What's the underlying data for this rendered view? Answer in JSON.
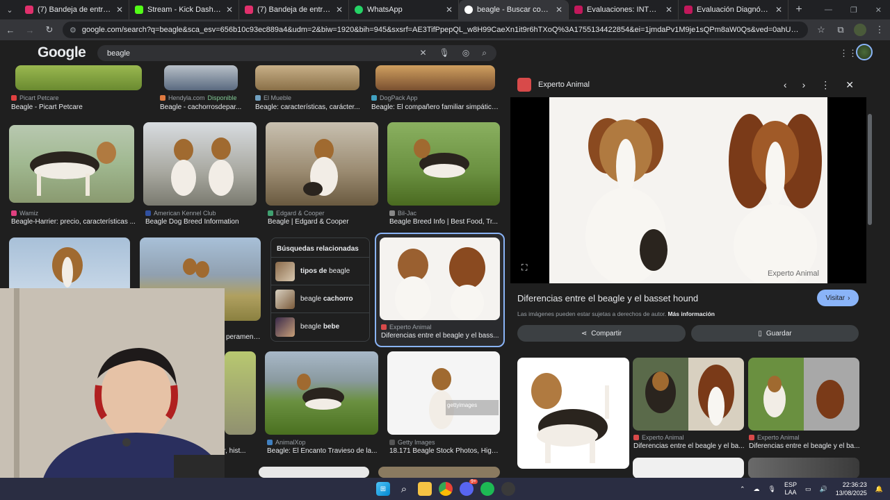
{
  "browser": {
    "tabs": [
      {
        "title": "(7) Bandeja de entrada • Chats",
        "color": "#e1306c"
      },
      {
        "title": "Stream - Kick Dashboard",
        "color": "#53fc18"
      },
      {
        "title": "(7) Bandeja de entrada • Chats",
        "color": "#e1306c"
      },
      {
        "title": "WhatsApp",
        "color": "#25d366"
      },
      {
        "title": "beagle - Buscar con Google",
        "color": "#ffffff"
      },
      {
        "title": "Evaluaciones: INTRODUCCION",
        "color": "#c2185b"
      },
      {
        "title": "Evaluación Diagnóstica: INTRO",
        "color": "#c2185b"
      }
    ],
    "active_tab": 4,
    "url": "google.com/search?q=beagle&sca_esv=656b10c93ec889a4&udm=2&biw=1920&bih=945&sxsrf=AE3TifPpepQL_w8H99CaeXn1it9r6hTXoQ%3A1755134422854&ei=1jmdaPv1M9je1sQPm8aW0Qs&ved=0ahUKEwj7uLqekYmPAxVYr5UCHRujJboQ4dUDCBE..."
  },
  "google": {
    "logo": "Google",
    "query": "beagle"
  },
  "results": {
    "row1": [
      {
        "source": "Picart Petcare",
        "caption": "Beagle - Picart Petcare",
        "extra": ""
      },
      {
        "source": "Hendyla.com",
        "caption": "Beagle - cachorrosdepar...",
        "extra": "Disponible"
      },
      {
        "source": "El Mueble",
        "caption": "Beagle: características, carácter...",
        "extra": ""
      },
      {
        "source": "DogPack App",
        "caption": "Beagle: El compañero familiar simpático...",
        "extra": ""
      }
    ],
    "row2": [
      {
        "source": "Wamiz",
        "caption": "Beagle-Harrier: precio, características ..."
      },
      {
        "source": "American Kennel Club",
        "caption": "Beagle Dog Breed Information"
      },
      {
        "source": "Edgard & Cooper",
        "caption": "Beagle | Edgard & Cooper"
      },
      {
        "source": "Bil-Jac",
        "caption": "Beagle Breed Info | Best Food, Tr..."
      }
    ],
    "row3_partial_caption": "perament...",
    "related": {
      "heading": "Búsquedas relacionadas",
      "items": [
        {
          "bold_prefix": "tipos de",
          "text": " beagle"
        },
        {
          "bold_prefix": "",
          "text": "beagle ",
          "bold_suffix": "cachorro"
        },
        {
          "bold_prefix": "",
          "text": "beagle ",
          "bold_suffix": "bebe"
        }
      ]
    },
    "selected": {
      "source": "Experto Animal",
      "caption": "Diferencias entre el beagle y el bass..."
    },
    "row4": [
      {
        "source": "",
        "caption": "ter, hist..."
      },
      {
        "source": "AnimalXop",
        "caption": "Beagle: El Encanto Travieso de la..."
      },
      {
        "source": "Getty Images",
        "caption": "18.171 Beagle Stock Photos, High..."
      }
    ],
    "getty_watermark": "gettyimages"
  },
  "panel": {
    "site": "Experto Animal",
    "title": "Diferencias entre el beagle y el basset hound",
    "visit_label": "Visitar",
    "copyright": "Las imágenes pueden estar sujetas a derechos de autor.",
    "more_info": "Más información",
    "share_label": "Compartir",
    "save_label": "Guardar",
    "watermark": "Experto Animal",
    "similar": [
      {
        "source": "",
        "caption": ""
      },
      {
        "source": "Experto Animal",
        "caption": "Diferencias entre el beagle y el ba..."
      },
      {
        "source": "Experto Animal",
        "caption": "Diferencias entre el beagle y el ba..."
      }
    ]
  },
  "taskbar": {
    "lang_top": "ESP",
    "lang_bottom": "LAA",
    "time": "22:36:23",
    "date": "13/08/2025",
    "discord_badge": "9+"
  }
}
